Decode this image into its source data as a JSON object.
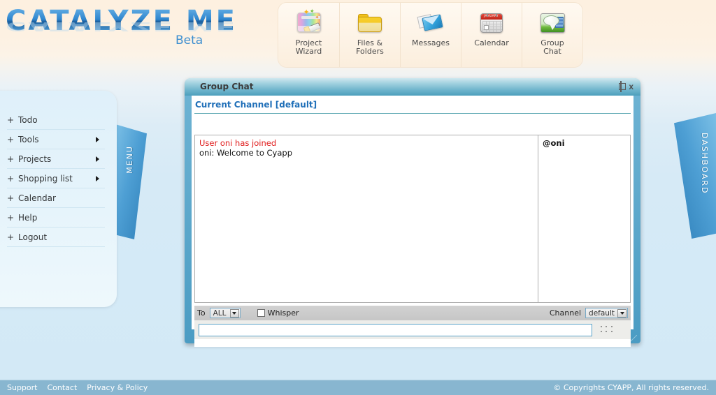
{
  "brand": {
    "name": "CATALYZE ME",
    "tagline": "Beta"
  },
  "toolbar": {
    "items": [
      {
        "label_line1": "Project",
        "label_line2": "Wizard",
        "icon": "project-wizard-icon"
      },
      {
        "label_line1": "Files &",
        "label_line2": "Folders",
        "icon": "folder-icon"
      },
      {
        "label_line1": "Messages",
        "label_line2": "",
        "icon": "envelope-icon"
      },
      {
        "label_line1": "Calendar",
        "label_line2": "",
        "icon": "calendar-icon"
      },
      {
        "label_line1": "Group",
        "label_line2": "Chat",
        "icon": "chat-bubble-icon"
      }
    ]
  },
  "sidebar": {
    "tab_label": "MENU",
    "items": [
      {
        "prefix": "+",
        "label": "Todo",
        "has_submenu": false
      },
      {
        "prefix": "+",
        "label": "Tools",
        "has_submenu": true
      },
      {
        "prefix": "+",
        "label": "Projects",
        "has_submenu": true
      },
      {
        "prefix": "+",
        "label": "Shopping list",
        "has_submenu": true
      },
      {
        "prefix": "+",
        "label": "Calendar",
        "has_submenu": false
      },
      {
        "prefix": "+",
        "label": "Help",
        "has_submenu": false
      },
      {
        "prefix": "+",
        "label": "Logout",
        "has_submenu": false
      }
    ]
  },
  "dashboard_tab": {
    "label": "DASHBOARD"
  },
  "chat_window": {
    "title": "Group Chat",
    "window_buttons": {
      "minimize": "minimize-icon",
      "maximize": "restore-icon",
      "close": "x"
    },
    "channel_header": "Current Channel [default]",
    "messages": [
      {
        "text": "User oni has joined",
        "type": "system"
      },
      {
        "text": "oni: Welcome to Cyapp",
        "type": "user"
      }
    ],
    "users": [
      {
        "name": "@oni"
      }
    ],
    "controls": {
      "to_label": "To",
      "to_value": "ALL",
      "to_options": [
        "ALL"
      ],
      "whisper_label": "Whisper",
      "whisper_checked": false,
      "channel_label": "Channel",
      "channel_value": "default",
      "channel_options": [
        "default"
      ]
    },
    "input": {
      "value": "",
      "placeholder": ""
    }
  },
  "footer": {
    "links": [
      "Support",
      "Contact",
      "Privacy & Policy"
    ],
    "copyright": "© Copyrights CYAPP, All rights reserved."
  },
  "colors": {
    "accent_blue": "#2a7fc9",
    "title_blue": "#1f6fb8",
    "system_msg_red": "#e01b1b",
    "footer_bg": "#88b6d0",
    "tab_blue": "#4e9fd4"
  }
}
